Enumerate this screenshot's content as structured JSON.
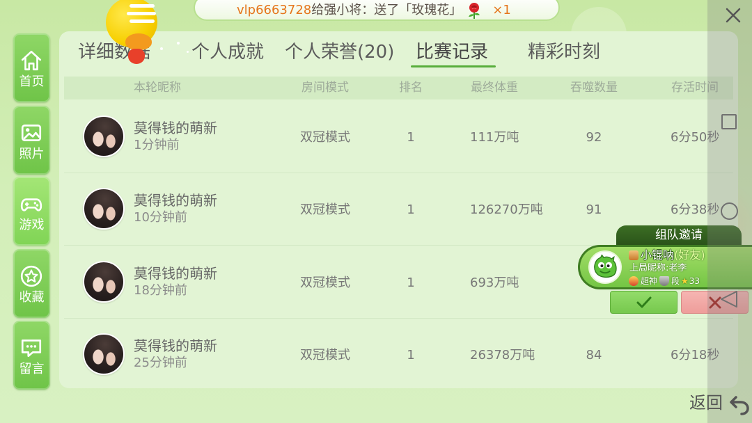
{
  "notification": {
    "sender": "vlp6663728",
    "message": "给强小将：送了「玫瑰花」",
    "gift_icon": "rose-icon",
    "count": "×1"
  },
  "sidebar": {
    "items": [
      {
        "label": "首页",
        "icon": "home-icon"
      },
      {
        "label": "照片",
        "icon": "photo-icon"
      },
      {
        "label": "游戏",
        "icon": "gamepad-icon",
        "active": true
      },
      {
        "label": "收藏",
        "icon": "star-icon"
      },
      {
        "label": "留言",
        "icon": "message-icon"
      }
    ]
  },
  "tabs": [
    {
      "label": "详细数据"
    },
    {
      "label": "个人成就"
    },
    {
      "label": "个人荣誉(20)"
    },
    {
      "label": "比赛记录",
      "active": true
    },
    {
      "label": "精彩时刻"
    }
  ],
  "match_table": {
    "columns": [
      "本轮昵称",
      "房间模式",
      "排名",
      "最终体重",
      "吞噬数量",
      "存活时间"
    ],
    "rows": [
      {
        "nickname": "莫得钱的萌新",
        "time_ago": "1分钟前",
        "mode": "双冠模式",
        "rank": "1",
        "final_weight": "111万吨",
        "eaten": "92",
        "survival_time": "6分50秒"
      },
      {
        "nickname": "莫得钱的萌新",
        "time_ago": "10分钟前",
        "mode": "双冠模式",
        "rank": "1",
        "final_weight": "126270万吨",
        "eaten": "91",
        "survival_time": "6分38秒"
      },
      {
        "nickname": "莫得钱的萌新",
        "time_ago": "18分钟前",
        "mode": "双冠模式",
        "rank": "1",
        "final_weight": "693万吨"
      },
      {
        "nickname": "莫得钱的萌新",
        "time_ago": "25分钟前",
        "mode": "双冠模式",
        "rank": "1",
        "final_weight": "26378万吨",
        "eaten": "84",
        "survival_time": "6分18秒"
      }
    ]
  },
  "team_invite": {
    "title": "组队邀请",
    "name": "小锟呐",
    "relation": "(好友)",
    "last_nickname": "上局昵称:老李",
    "rank_title": "超神",
    "rank_unit": "段",
    "stars": "33",
    "accept_icon": "check-icon",
    "decline_icon": "x-icon"
  },
  "navbar": {
    "icons": [
      "close-icon",
      "square-icon",
      "circle-icon",
      "triangle-back-icon"
    ]
  },
  "back_button": {
    "label": "返回",
    "icon": "back-arrow-icon"
  },
  "colors": {
    "accent_green": "#57ad3a",
    "sidebar_green": "#7cc952",
    "sender_orange": "#e5761c",
    "invite_dark_green": "#2e5a1b",
    "decline_pink": "#f0a4a1"
  }
}
